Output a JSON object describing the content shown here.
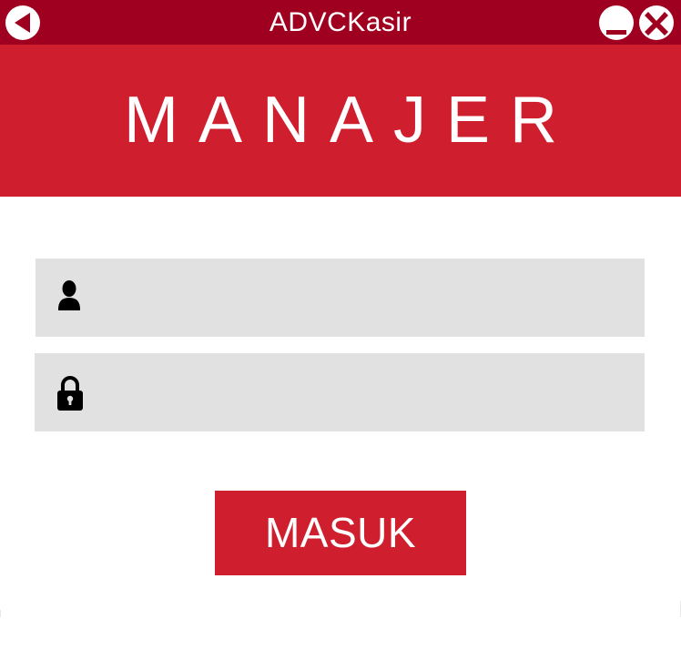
{
  "window": {
    "title": "ADVCKasir"
  },
  "titlebar_buttons": {
    "back_icon": "back-arrow-icon",
    "minimize_icon": "minimize-icon",
    "close_icon": "close-icon"
  },
  "header": {
    "title": "MANAJER"
  },
  "form": {
    "username": {
      "icon": "user-icon",
      "value": "",
      "placeholder": ""
    },
    "password": {
      "icon": "lock-icon",
      "value": "",
      "placeholder": ""
    },
    "submit_label": "MASUK"
  },
  "colors": {
    "titlebar": "#a0001f",
    "accent": "#cf1f2f",
    "field_bg": "#e1e1e1",
    "text_on_accent": "#ffffff"
  }
}
